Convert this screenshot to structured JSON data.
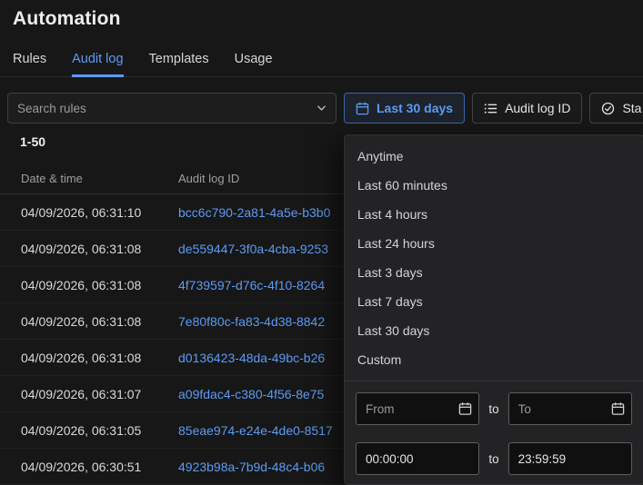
{
  "page": {
    "title": "Automation"
  },
  "tabs": [
    {
      "label": "Rules",
      "active": false
    },
    {
      "label": "Audit log",
      "active": true
    },
    {
      "label": "Templates",
      "active": false
    },
    {
      "label": "Usage",
      "active": false
    }
  ],
  "toolbar": {
    "search_placeholder": "Search rules",
    "time_range_label": "Last 30 days",
    "audit_log_id_label": "Audit log ID",
    "status_label": "Sta"
  },
  "results_count": "1-50",
  "table": {
    "columns": [
      "Date & time",
      "Audit log ID"
    ],
    "rows": [
      {
        "datetime": "04/09/2026, 06:31:10",
        "audit_log_id": "bcc6c790-2a81-4a5e-b3b0"
      },
      {
        "datetime": "04/09/2026, 06:31:08",
        "audit_log_id": "de559447-3f0a-4cba-9253"
      },
      {
        "datetime": "04/09/2026, 06:31:08",
        "audit_log_id": "4f739597-d76c-4f10-8264"
      },
      {
        "datetime": "04/09/2026, 06:31:08",
        "audit_log_id": "7e80f80c-fa83-4d38-8842"
      },
      {
        "datetime": "04/09/2026, 06:31:08",
        "audit_log_id": "d0136423-48da-49bc-b26"
      },
      {
        "datetime": "04/09/2026, 06:31:07",
        "audit_log_id": "a09fdac4-c380-4f56-8e75"
      },
      {
        "datetime": "04/09/2026, 06:31:05",
        "audit_log_id": "85eae974-e24e-4de0-8517"
      },
      {
        "datetime": "04/09/2026, 06:30:51",
        "audit_log_id": "4923b98a-7b9d-48c4-b06"
      }
    ]
  },
  "time_dropdown": {
    "options": [
      "Anytime",
      "Last 60 minutes",
      "Last 4 hours",
      "Last 24 hours",
      "Last 3 days",
      "Last 7 days",
      "Last 30 days",
      "Custom"
    ],
    "from_placeholder": "From",
    "to_placeholder": "To",
    "separator": "to",
    "start_time": "00:00:00",
    "end_time": "23:59:59"
  },
  "colors": {
    "accent_blue": "#5c9bf5",
    "link_blue": "#5c9bf5",
    "page_bg": "#171717",
    "panel_bg": "#232326"
  }
}
